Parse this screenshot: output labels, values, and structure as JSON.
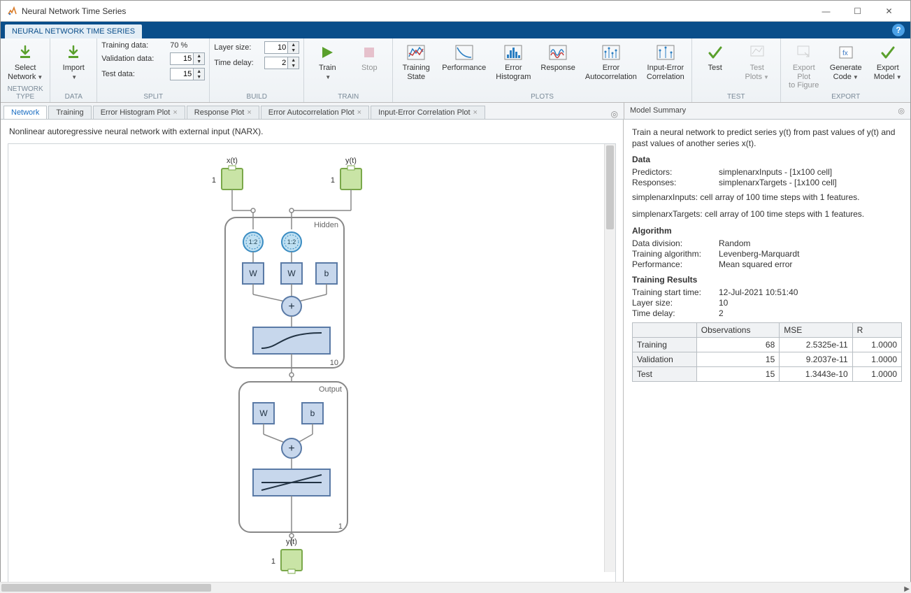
{
  "window": {
    "title": "Neural Network Time Series"
  },
  "ribbon_tab": "NEURAL NETWORK TIME SERIES",
  "toolstrip": {
    "network_type": {
      "label": "NETWORK TYPE",
      "select_network": "Select\nNetwork"
    },
    "data": {
      "label": "DATA",
      "import": "Import"
    },
    "split": {
      "label": "SPLIT",
      "training_label": "Training data:",
      "training_val": "70 %",
      "validation_label": "Validation data:",
      "validation_val": "15",
      "test_label": "Test data:",
      "test_val": "15"
    },
    "build": {
      "label": "BUILD",
      "layer_size_label": "Layer size:",
      "layer_size_val": "10",
      "time_delay_label": "Time delay:",
      "time_delay_val": "2"
    },
    "train": {
      "label": "TRAIN",
      "train_btn": "Train",
      "stop_btn": "Stop"
    },
    "plots": {
      "label": "PLOTS",
      "training_state": "Training\nState",
      "performance": "Performance",
      "error_hist": "Error\nHistogram",
      "response": "Response",
      "error_auto": "Error\nAutocorrelation",
      "input_error": "Input-Error\nCorrelation"
    },
    "test": {
      "label": "TEST",
      "test_btn": "Test",
      "test_plots": "Test\nPlots"
    },
    "export": {
      "label": "EXPORT",
      "export_plot": "Export Plot\nto Figure",
      "gen_code": "Generate\nCode",
      "export_model": "Export\nModel"
    }
  },
  "doc_tabs": [
    {
      "label": "Network",
      "active": true,
      "closable": false
    },
    {
      "label": "Training",
      "active": false,
      "closable": false
    },
    {
      "label": "Error Histogram Plot",
      "active": false,
      "closable": true
    },
    {
      "label": "Response Plot",
      "active": false,
      "closable": true
    },
    {
      "label": "Error Autocorrelation Plot",
      "active": false,
      "closable": true
    },
    {
      "label": "Input-Error Correlation Plot",
      "active": false,
      "closable": true
    }
  ],
  "left_desc": "Nonlinear autoregressive neural network with external input (NARX).",
  "diagram": {
    "input_x": "x(t)",
    "input_y": "y(t)",
    "output_y": "y(t)",
    "hidden_label": "Hidden",
    "output_label": "Output",
    "delay": "1:2",
    "w": "W",
    "b": "b",
    "plus": "+",
    "one": "1",
    "hidden_size": "10",
    "output_size": "1"
  },
  "model_summary_title": "Model Summary",
  "summary": {
    "intro": "Train a neural network to predict series y(t) from past values of y(t) and past values of another series x(t).",
    "data_hdr": "Data",
    "predictors_k": "Predictors:",
    "predictors_v": "simplenarxInputs - [1x100 cell]",
    "responses_k": "Responses:",
    "responses_v": "simplenarxTargets - [1x100 cell]",
    "line1": "simplenarxInputs: cell array of 100 time steps with 1 features.",
    "line2": "simplenarxTargets: cell array of 100 time steps with 1 features.",
    "algo_hdr": "Algorithm",
    "datadiv_k": "Data division:",
    "datadiv_v": "Random",
    "trainalg_k": "Training algorithm:",
    "trainalg_v": "Levenberg-Marquardt",
    "perf_k": "Performance:",
    "perf_v": "Mean squared error",
    "results_hdr": "Training Results",
    "start_k": "Training start time:",
    "start_v": "12-Jul-2021 10:51:40",
    "layer_k": "Layer size:",
    "layer_v": "10",
    "delay_k": "Time delay:",
    "delay_v": "2",
    "table": {
      "headers": [
        "",
        "Observations",
        "MSE",
        "R"
      ],
      "rows": [
        {
          "name": "Training",
          "obs": "68",
          "mse": "2.5325e-11",
          "r": "1.0000"
        },
        {
          "name": "Validation",
          "obs": "15",
          "mse": "9.2037e-11",
          "r": "1.0000"
        },
        {
          "name": "Test",
          "obs": "15",
          "mse": "1.3443e-10",
          "r": "1.0000"
        }
      ]
    }
  }
}
